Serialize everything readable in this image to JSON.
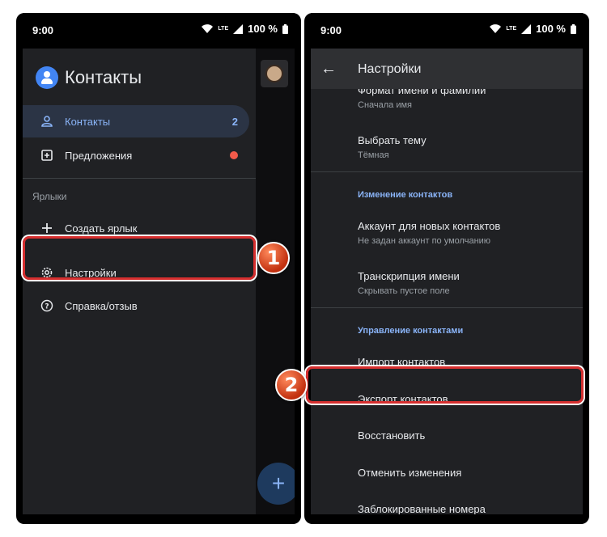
{
  "status": {
    "time": "9:00",
    "network": "LTE",
    "battery": "100 %"
  },
  "left": {
    "app_title": "Контакты",
    "nav": [
      {
        "label": "Контакты",
        "count": "2",
        "icon": "person-icon"
      },
      {
        "label": "Предложения",
        "icon": "suggestions-icon"
      }
    ],
    "labels_section": "Ярлыки",
    "create_label": "Создать ярлык",
    "settings": "Настройки",
    "help": "Справка/отзыв",
    "fab_icon": "+",
    "badge": "1"
  },
  "right": {
    "title": "Настройки",
    "back_icon": "←",
    "name_format": {
      "title": "Формат имени и фамилии",
      "subtitle": "Сначала имя"
    },
    "theme": {
      "title": "Выбрать тему",
      "subtitle": "Тёмная"
    },
    "section_edit": "Изменение контактов",
    "account": {
      "title": "Аккаунт для новых контактов",
      "subtitle": "Не задан аккаунт по умолчанию"
    },
    "transcription": {
      "title": "Транскрипция имени",
      "subtitle": "Скрывать пустое поле"
    },
    "section_manage": "Управление контактами",
    "import": "Импорт контактов",
    "export": "Экспорт контактов",
    "restore": "Восстановить",
    "undo": "Отменить изменения",
    "blocked": "Заблокированные номера",
    "badge": "2"
  },
  "colors": {
    "accent": "#8ab4f8",
    "highlight": "#d62f2f",
    "background": "#202124"
  }
}
